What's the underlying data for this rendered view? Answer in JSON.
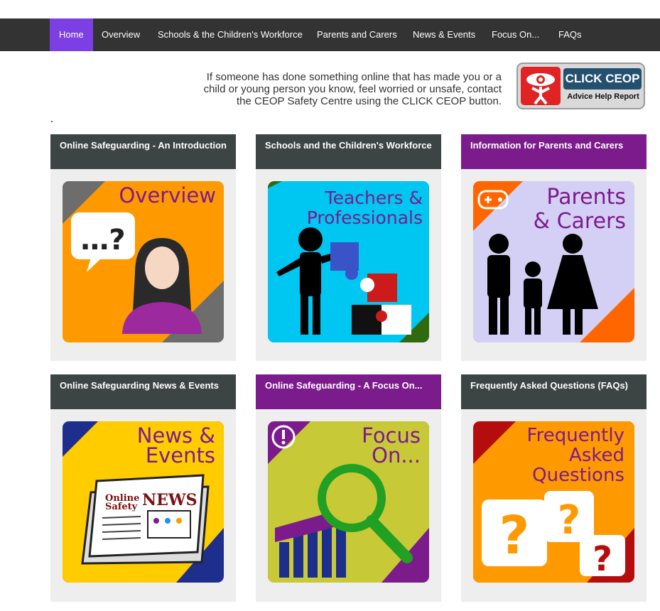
{
  "nav": {
    "items": [
      {
        "label": "Home",
        "active": true
      },
      {
        "label": "Overview"
      },
      {
        "label": "Schools & the Children's Workforce"
      },
      {
        "label": "Parents and Carers"
      },
      {
        "label": "News & Events"
      },
      {
        "label": "Focus On..."
      },
      {
        "label": "FAQs"
      }
    ]
  },
  "ceop": {
    "line1": "If someone has done something online that has made you or a",
    "line2": "child or young person you know, feel worried or unsafe, contact",
    "line3": "the CEOP Safety Centre using the CLICK CEOP button.",
    "button_title": "CLICK CEOP",
    "button_sub": "Advice Help Report"
  },
  "colors": {
    "nav_bg": "#333333",
    "nav_active": "#7b3fe4",
    "header_dark": "#3c4444",
    "header_purple": "#7c1b8c"
  },
  "cards": [
    {
      "header": "Online Safeguarding - An Introduction",
      "image_title": "Overview",
      "icon": "speech-bubble-person-icon"
    },
    {
      "header": "Schools and the Children's Workforce",
      "image_title_1": "Teachers &",
      "image_title_2": "Professionals",
      "icon": "teacher-puzzle-icon"
    },
    {
      "header": "Information for Parents and Carers",
      "image_title_1": "Parents",
      "image_title_2": "& Carers",
      "icon": "family-icon"
    },
    {
      "header": "Online Safeguarding News & Events",
      "image_title_1": "News &",
      "image_title_2": "Events",
      "paper_1": "Online",
      "paper_2": "Safety",
      "paper_3": "NEWS",
      "icon": "newspaper-icon"
    },
    {
      "header": "Online Safeguarding - A Focus On...",
      "image_title_1": "Focus",
      "image_title_2": "On...",
      "icon": "magnifier-chart-icon"
    },
    {
      "header": "Frequently Asked Questions (FAQs)",
      "image_title_1": "Frequently",
      "image_title_2": "Asked",
      "image_title_3": "Questions",
      "icon": "question-marks-icon"
    }
  ]
}
